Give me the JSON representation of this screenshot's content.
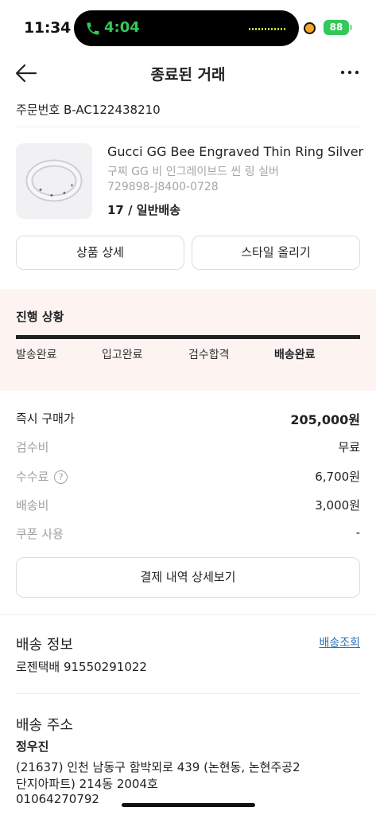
{
  "status": {
    "time": "11:34",
    "call_time": "4:04",
    "battery": "88"
  },
  "header": {
    "title": "종료된 거래",
    "back_icon": "arrow-left-icon",
    "more_icon": "more-dots-icon"
  },
  "order": {
    "number": "주문번호 B-AC122438210"
  },
  "product": {
    "name": "Gucci GG Bee Engraved Thin Ring Silver",
    "name_ko": "구찌 GG 비 인그레이브드 씬 링 실버",
    "code": "729898-J8400-0728",
    "option": "17 / 일반배송"
  },
  "buttons": {
    "detail": "상품 상세",
    "style": "스타일 올리기",
    "payment_detail": "결제 내역 상세보기"
  },
  "progress": {
    "title": "진행 상황",
    "steps": [
      "발송완료",
      "입고완료",
      "검수합격",
      "배송완료"
    ],
    "current": "배송완료"
  },
  "payment": {
    "price_label": "즉시 구매가",
    "price_value": "205,000원",
    "inspection_label": "검수비",
    "inspection_value": "무료",
    "fee_label": "수수료",
    "fee_help": "?",
    "fee_value": "6,700원",
    "shipping_label": "배송비",
    "shipping_value": "3,000원",
    "coupon_label": "쿠폰 사용",
    "coupon_value": "-"
  },
  "delivery": {
    "title": "배송 정보",
    "track_link": "배송조회",
    "courier": "로젠택배 91550291022"
  },
  "address": {
    "title": "배송 주소",
    "name": "정우진",
    "line1": "(21637) 인천 남동구 함박뫼로 439 (논현동, 논현주공2",
    "line2": "단지아파트) 214동 2004호",
    "phone": "01064270792"
  },
  "colors": {
    "accent": "#34c759",
    "progress_bg": "#fdf4f2",
    "link": "#2f6fb5"
  }
}
